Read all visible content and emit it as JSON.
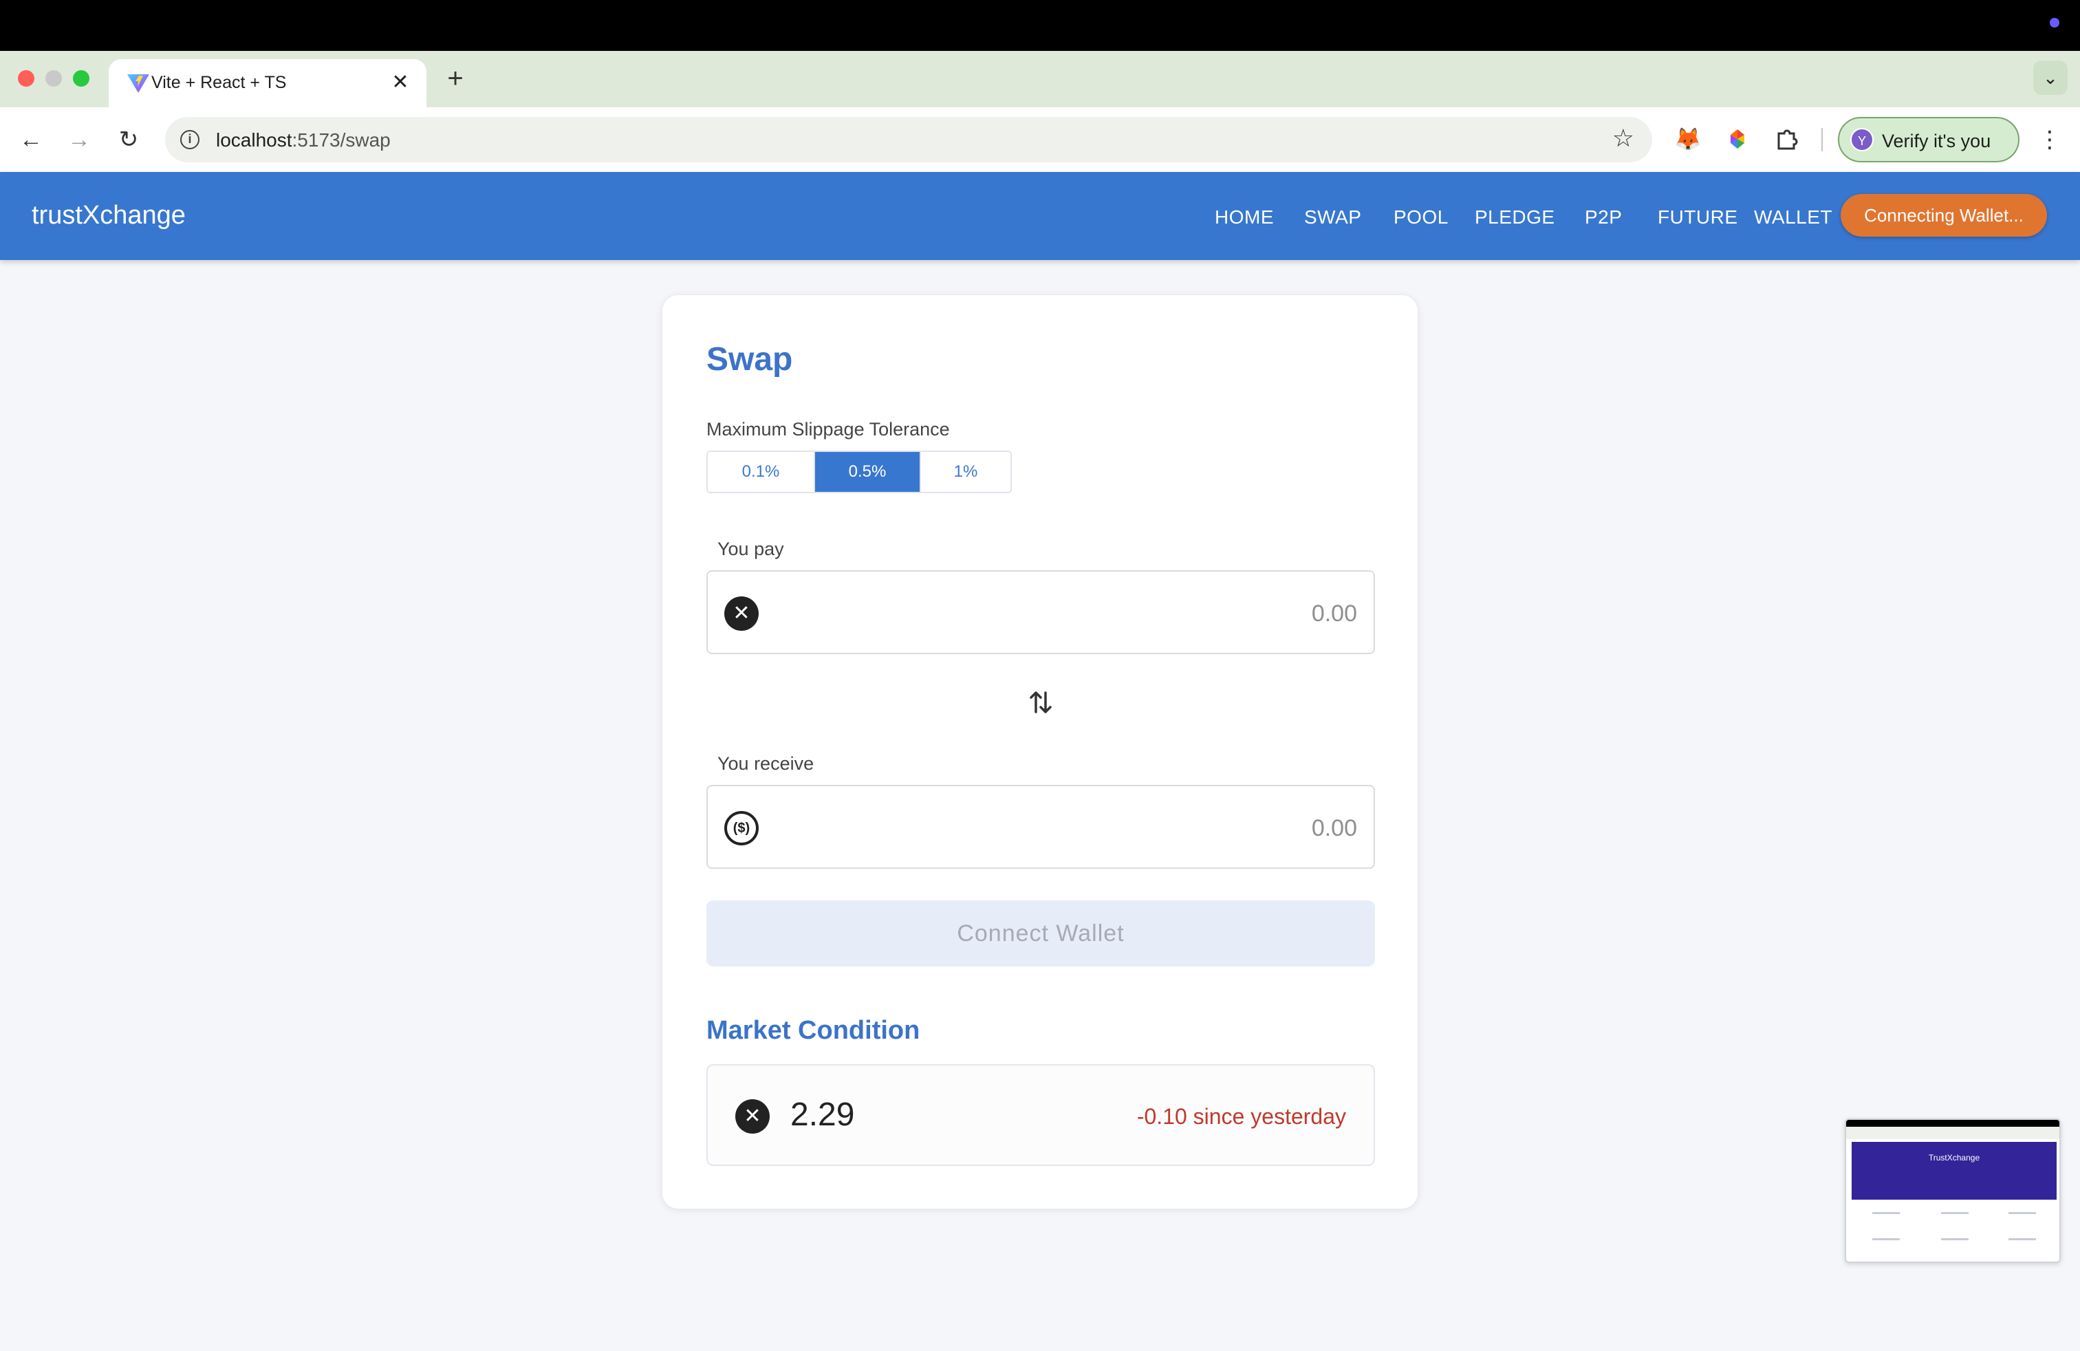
{
  "browser": {
    "tab_title": "Vite + React + TS",
    "new_tab": "+",
    "tab_close": "✕",
    "url_host": "localhost",
    "url_path": ":5173/swap",
    "profile_initial": "Y",
    "profile_label": "Verify it's you"
  },
  "app": {
    "brand": "trustXchange",
    "nav": [
      "HOME",
      "SWAP",
      "POOL",
      "PLEDGE",
      "P2P",
      "FUTURE",
      "WALLET"
    ],
    "connecting_label": "Connecting Wallet..."
  },
  "swap": {
    "title": "Swap",
    "slippage_label": "Maximum Slippage Tolerance",
    "slippage_options": [
      "0.1%",
      "0.5%",
      "1%"
    ],
    "slippage_selected": "0.5%",
    "pay_label": "You pay",
    "pay_placeholder": "0.00",
    "receive_label": "You receive",
    "receive_placeholder": "0.00",
    "connect_label": "Connect Wallet",
    "pay_token_icon": "xrp-icon",
    "receive_token_icon": "usd-coin-icon"
  },
  "market": {
    "title": "Market Condition",
    "price": "2.29",
    "change": "-0.10 since yesterday",
    "change_color": "#c0392b"
  },
  "thumbnail": {
    "title": "TrustXchange"
  },
  "colors": {
    "brand_blue": "#3877cf",
    "accent_orange": "#e07530"
  }
}
